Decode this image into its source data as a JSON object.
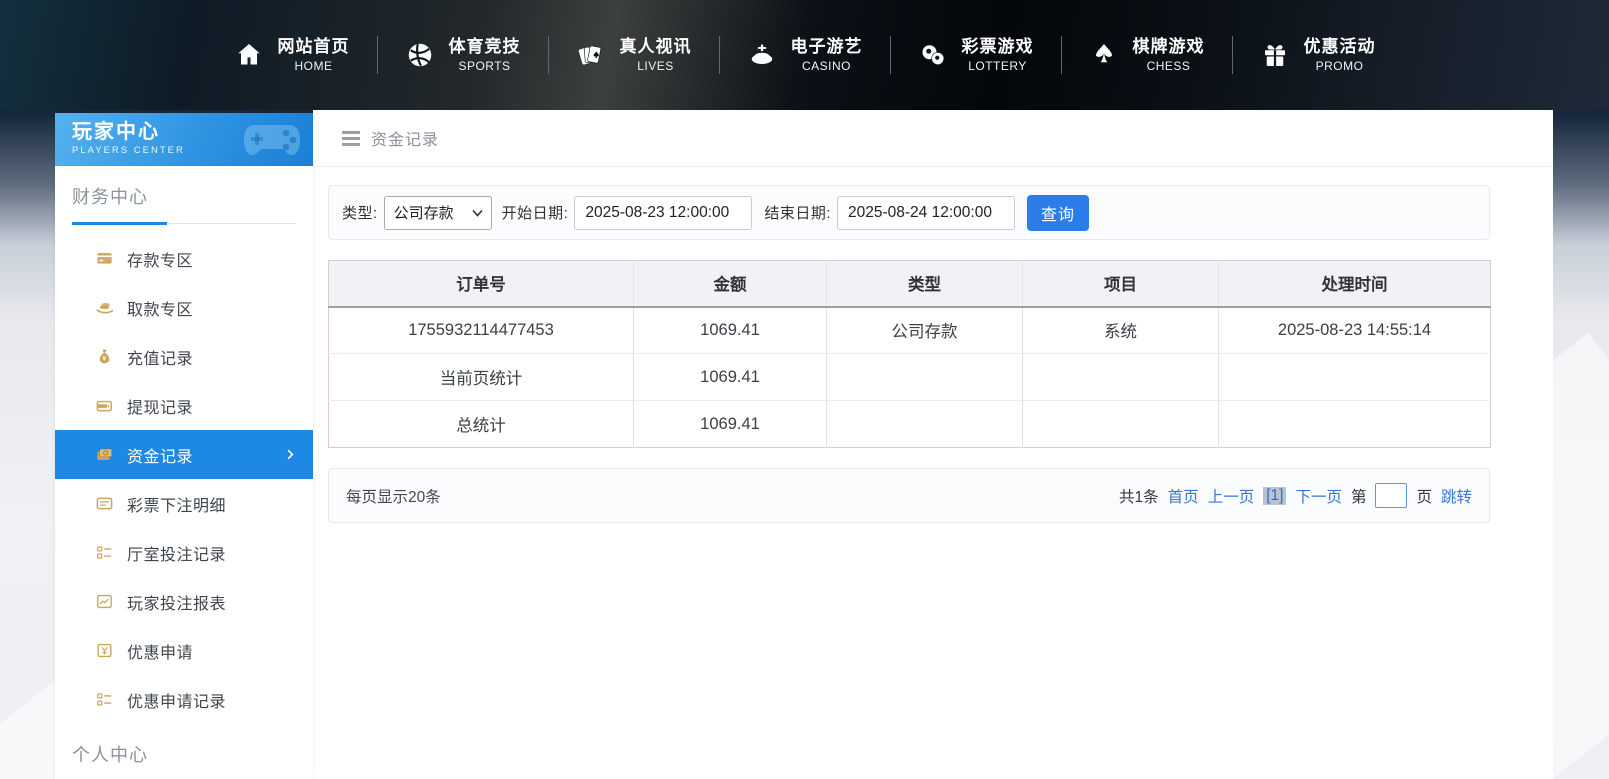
{
  "nav": {
    "items": [
      {
        "zh": "网站首页",
        "en": "HOME",
        "icon": "home-icon"
      },
      {
        "zh": "体育竞技",
        "en": "SPORTS",
        "icon": "sports-ball-icon"
      },
      {
        "zh": "真人视讯",
        "en": "LIVES",
        "icon": "playing-cards-icon"
      },
      {
        "zh": "电子游艺",
        "en": "CASINO",
        "icon": "roulette-icon"
      },
      {
        "zh": "彩票游戏",
        "en": "LOTTERY",
        "icon": "lottery-balls-icon"
      },
      {
        "zh": "棋牌游戏",
        "en": "CHESS",
        "icon": "spade-icon"
      },
      {
        "zh": "优惠活动",
        "en": "PROMO",
        "icon": "gift-icon"
      }
    ]
  },
  "sidebar": {
    "header": {
      "title": "玩家中心",
      "subtitle": "PLAYERS CENTER",
      "icon": "gamepad-icon"
    },
    "section_finance": "财务中心",
    "section_personal": "个人中心",
    "items": [
      {
        "label": "存款专区",
        "icon": "deposit-card-icon"
      },
      {
        "label": "取款专区",
        "icon": "withdraw-hand-icon"
      },
      {
        "label": "充值记录",
        "icon": "moneybag-icon"
      },
      {
        "label": "提现记录",
        "icon": "wallet-icon"
      },
      {
        "label": "资金记录",
        "icon": "funds-wallet-icon",
        "active": true
      },
      {
        "label": "彩票下注明细",
        "icon": "ticket-icon"
      },
      {
        "label": "厅室投注记录",
        "icon": "list-icon"
      },
      {
        "label": "玩家投注报表",
        "icon": "report-chart-icon"
      },
      {
        "label": "优惠申请",
        "icon": "promo-apply-icon"
      },
      {
        "label": "优惠申请记录",
        "icon": "list-icon"
      }
    ]
  },
  "breadcrumb": {
    "title": "资金记录",
    "icon": "hamburger-icon"
  },
  "filters": {
    "type_label": "类型:",
    "type_value": "公司存款",
    "start_label": "开始日期:",
    "start_value": "2025-08-23 12:00:00",
    "end_label": "结束日期:",
    "end_value": "2025-08-24 12:00:00",
    "query_label": "查询"
  },
  "table": {
    "headers": [
      "订单号",
      "金额",
      "类型",
      "项目",
      "处理时间"
    ],
    "rows": [
      [
        "1755932114477453",
        "1069.41",
        "公司存款",
        "系统",
        "2025-08-23 14:55:14"
      ],
      [
        "当前页统计",
        "1069.41",
        "",
        "",
        ""
      ],
      [
        "总统计",
        "1069.41",
        "",
        "",
        ""
      ]
    ]
  },
  "pagination": {
    "per_page": "每页显示20条",
    "total": "共1条",
    "first": "首页",
    "prev": "上一页",
    "current": "[1]",
    "next": "下一页",
    "page_prefix": "第",
    "page_input_value": "",
    "page_suffix": "页",
    "jump": "跳转"
  },
  "colors": {
    "accent_blue": "#1e88e5",
    "button_blue": "#2b7de9",
    "link_blue": "#3577d4",
    "sidebar_gold": "#c9a258",
    "table_border_pink": "#f0dde0",
    "header_dark": "#0b1016"
  }
}
